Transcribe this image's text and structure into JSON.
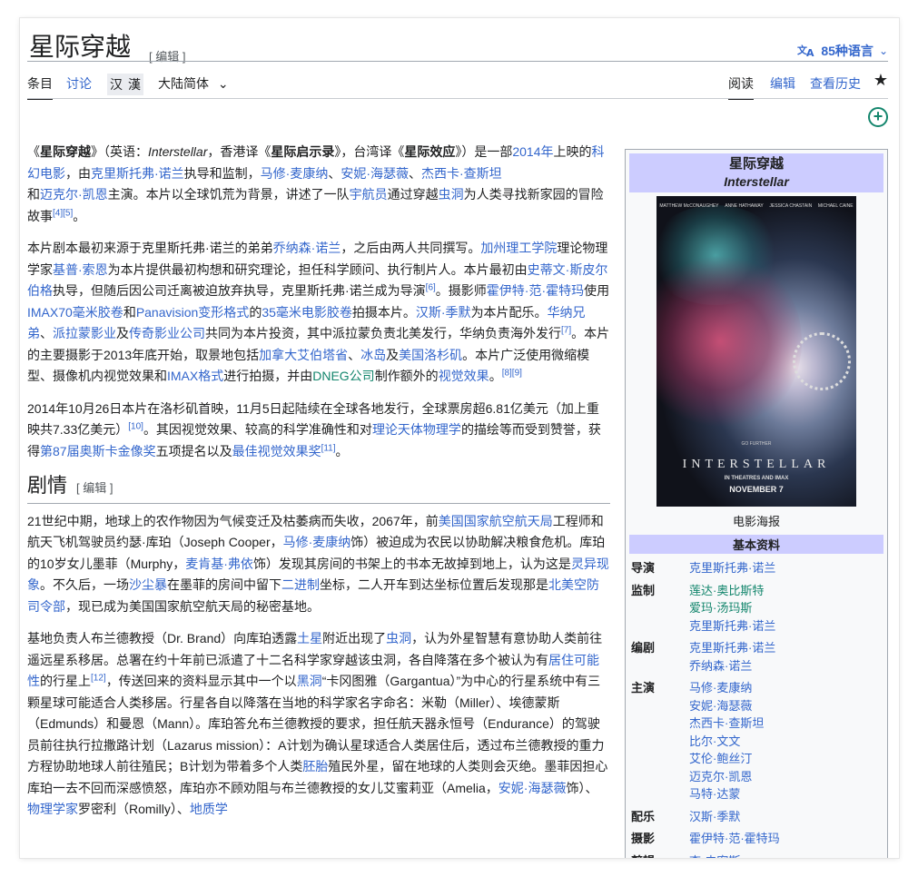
{
  "header": {
    "title": "星际穿越",
    "title_edit": "[ 编辑 ]",
    "languages": "85种语言",
    "lang_icon": "translate-icon"
  },
  "tabs": {
    "article": "条目",
    "talk": "讨论",
    "hant": "汉",
    "hans": "漢",
    "variant": "大陆简体",
    "read": "阅读",
    "edit": "编辑",
    "history": "查看历史"
  },
  "body": {
    "p1": {
      "a": "《",
      "b_title": "星际穿越",
      "c": "》（英语：",
      "en": "Interstellar",
      "d": "，香港译《",
      "hk": "星际启示录",
      "e": "》，台湾译《",
      "tw": "星际效应",
      "f": "》）是一部",
      "l_year": "2014年",
      "g": "上映的",
      "l_scifi": "科幻电影",
      "h": "，由",
      "l_nolan": "克里斯托弗·诺兰",
      "i": "执导和监制，",
      "l_mcc": "马修·麦康纳",
      "j": "、",
      "l_hath": "安妮·海瑟薇",
      "k": "、",
      "l_chas": "杰西卡·查斯坦",
      "l": "和",
      "l_caine": "迈克尔·凯恩",
      "m": "主演。本片以全球饥荒为背景，讲述了一队",
      "l_astro": "宇航员",
      "n": "通过穿越",
      "l_worm": "虫洞",
      "o": "为人类寻找新家园的冒险故事",
      "ref": "[4][5]",
      "end": "。"
    },
    "p2": {
      "a": "本片剧本最初来源于克里斯托弗·诺兰的弟弟",
      "l_jon": "乔纳森·诺兰",
      "b": "，之后由两人共同撰写。",
      "l_caltech": "加州理工学院",
      "c": "理论物理学家",
      "l_kip": "基普·索恩",
      "d": "为本片提供最初构想和研究理论，担任科学顾问、执行制片人。本片最初由",
      "l_spiel": "史蒂文·斯皮尔伯格",
      "e": "执导，但随后因公司迁离被迫放弃执导，克里斯托弗·诺兰成为导演",
      "ref6": "[6]",
      "f": "。摄影师",
      "l_hoyte": "霍伊特·范·霍特玛",
      "g": "使用",
      "l_imax70": "IMAX70毫米胶卷",
      "h": "和",
      "l_pana": "Panavision变形格式",
      "i": "的",
      "l_35": "35毫米电影胶卷",
      "j": "拍摄本片。",
      "l_zimmer": "汉斯·季默",
      "k": "为本片配乐。",
      "l_wb": "华纳兄弟",
      "l": "、",
      "l_para": "派拉蒙影业",
      "m": "及",
      "l_legend": "传奇影业公司",
      "n": "共同为本片投资，其中派拉蒙负责北美发行，华纳负责海外发行",
      "ref7": "[7]",
      "o": "。本片的主要摄影于2013年底开始，取景地包括",
      "l_alberta": "加拿大艾伯塔省",
      "p": "、",
      "l_ice": "冰岛",
      "q": "及",
      "l_la": "美国洛杉矶",
      "r": "。本片广泛使用微缩模型、摄像机内视觉效果和",
      "l_imax": "IMAX格式",
      "s": "进行拍摄，并由",
      "l_dneg": "DNEG公司",
      "t": "制作额外的",
      "l_vfx": "视觉效果",
      "u": "。",
      "ref89": "[8][9]"
    },
    "p3": {
      "a": "2014年10月26日本片在洛杉矶首映，11月5日起陆续在全球各地发行，全球票房超6.81亿美元（加上重映共7.33亿美元）",
      "ref10": "[10]",
      "b": "。其因视觉效果、较高的科学准确性和对",
      "l_phys": "理论天体物理学",
      "c": "的描绘等而受到赞誉，获得",
      "l_oscar": "第87届奥斯卡金像奖",
      "d": "五项提名以及",
      "l_bestvfx": "最佳视觉效果奖",
      "ref11": "[11]",
      "e": "。"
    },
    "plot_heading": "剧情",
    "plot_edit": "[ 编辑 ]",
    "p4": {
      "a": "21世纪中期，地球上的农作物因为气候变迁及枯萎病而失收，2067年，前",
      "l_nasa": "美国国家航空航天局",
      "b": "工程师和航天飞机驾驶员约瑟·库珀（Joseph Cooper，",
      "l_mcc": "马修·麦康纳",
      "c": "饰）被迫成为农民以协助解决粮食危机。库珀的10岁女儿墨菲（Murphy，",
      "l_foy": "麦肯基·弗依",
      "d": "饰）发现其房间的书架上的书本无故掉到地上，认为这是",
      "l_ghost": "灵异现象",
      "e": "。不久后，一场",
      "l_dust": "沙尘暴",
      "f": "在墨菲的房间中留下",
      "l_bin": "二进制",
      "g": "坐标，二人开车到达坐标位置后发现那是",
      "l_norad": "北美空防司令部",
      "h": "，现已成为美国国家航空航天局的秘密基地。"
    },
    "p5": {
      "a": "基地负责人布兰德教授（Dr. Brand）向库珀透露",
      "l_saturn": "土星",
      "b": "附近出现了",
      "l_worm": "虫洞",
      "c": "，认为外星智慧有意协助人类前往遥远星系移居。总署在约十年前已派遣了十二名科学家穿越该虫洞，各自降落在多个被认为有",
      "l_hab": "居住可能性",
      "d": "的行星上",
      "ref12": "[12]",
      "e": "，传送回来的资料显示其中一个以",
      "l_bh": "黑洞",
      "f": "“卡冈图雅（Gargantua）”为中心的行星系统中有三颗星球可能适合人类移居。行星各自以降落在当地的科学家名字命名：米勒（Miller）、埃德蒙斯（Edmunds）和曼恩（Mann）。库珀答允布兰德教授的要求，担任航天器永恒号（Endurance）的驾驶员前往执行拉撒路计划（Lazarus mission）：A计划为确认星球适合人类居住后，透过布兰德教授的重力方程协助地球人前往殖民；B计划为带着多个人类",
      "l_embryo": "胚胎",
      "g": "殖民外星，留在地球的人类则会灭绝。墨菲因担心库珀一去不回而深感愤怒，库珀亦不顾劝阻与布兰德教授的女儿艾蜜莉亚（Amelia，",
      "l_hath": "安妮·海瑟薇",
      "h": "饰）、",
      "l_physicist": "物理学家",
      "i": "罗密利（Romilly）、",
      "l_geo": "地质学"
    }
  },
  "infobox": {
    "title": "星际穿越",
    "subtitle": "Interstellar",
    "poster": {
      "actors": [
        "MATTHEW McCONAUGHEY",
        "ANNE HATHAWAY",
        "JESSICA CHASTAIN",
        "MICHAEL CAINE"
      ],
      "go_further": "GO FURTHER",
      "name": "INTERSTELLAR",
      "in_theaters": "IN THEATRES AND IMAX",
      "date": "NOVEMBER 7"
    },
    "caption": "电影海报",
    "section": "基本资料",
    "rows": [
      {
        "label": "导演",
        "values": [
          "克里斯托弗·诺兰"
        ]
      },
      {
        "label": "监制",
        "values": [
          "莲达·奥比斯特",
          "爱玛·汤玛斯",
          "克里斯托弗·诺兰"
        ]
      },
      {
        "label": "编剧",
        "values": [
          "克里斯托弗·诺兰",
          "乔纳森·诺兰"
        ]
      },
      {
        "label": "主演",
        "values": [
          "马修·麦康纳",
          "安妮·海瑟薇",
          "杰西卡·查斯坦",
          "比尔·文文",
          "艾伦·鲍丝汀",
          "迈克尔·凯恩",
          "马特·达蒙"
        ]
      },
      {
        "label": "配乐",
        "values": [
          "汉斯·季默"
        ]
      },
      {
        "label": "摄影",
        "values": [
          "霍伊特·范·霍特玛"
        ]
      },
      {
        "label": "剪辑",
        "values": [
          "李·史密斯"
        ]
      }
    ]
  },
  "colors": {
    "link": "#3366cc",
    "infobox_header": "#ccccff",
    "add_button": "#14866d"
  }
}
